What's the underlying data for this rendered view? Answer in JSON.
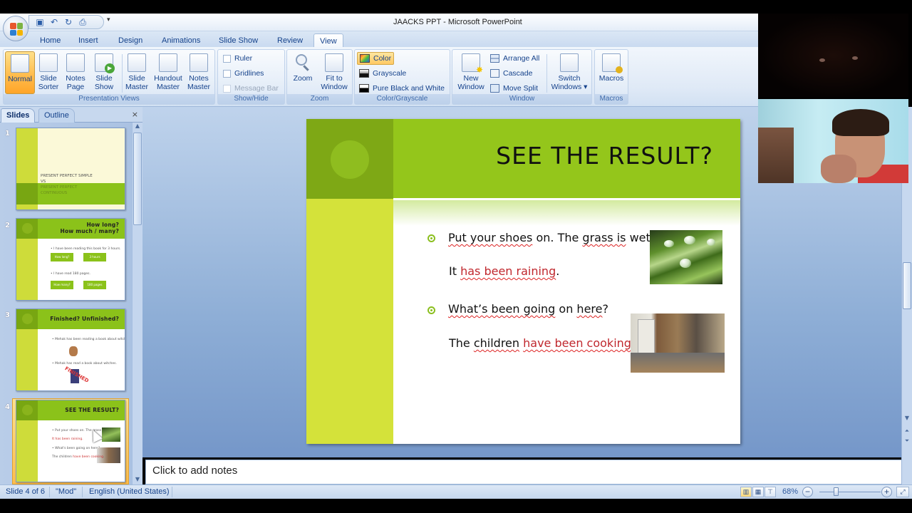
{
  "window": {
    "title": "JAACKS PPT - Microsoft PowerPoint"
  },
  "quick_access": [
    {
      "name": "save-icon",
      "glyph": "💾"
    },
    {
      "name": "undo-icon",
      "glyph": "↶"
    },
    {
      "name": "redo-icon",
      "glyph": "↻"
    },
    {
      "name": "print-icon",
      "glyph": "⎙"
    }
  ],
  "quick_access_more": "▾",
  "tabs": [
    "Home",
    "Insert",
    "Design",
    "Animations",
    "Slide Show",
    "Review",
    "View"
  ],
  "active_tab": "View",
  "ribbon": {
    "presentation_views": {
      "label": "Presentation Views",
      "buttons": [
        {
          "line1": "Normal",
          "line2": "",
          "active": true
        },
        {
          "line1": "Slide",
          "line2": "Sorter"
        },
        {
          "line1": "Notes",
          "line2": "Page"
        },
        {
          "line1": "Slide",
          "line2": "Show"
        },
        {
          "line1": "Slide",
          "line2": "Master"
        },
        {
          "line1": "Handout",
          "line2": "Master"
        },
        {
          "line1": "Notes",
          "line2": "Master"
        }
      ]
    },
    "show_hide": {
      "label": "Show/Hide",
      "items": [
        {
          "label": "Ruler",
          "checked": false,
          "enabled": true
        },
        {
          "label": "Gridlines",
          "checked": false,
          "enabled": true
        },
        {
          "label": "Message Bar",
          "checked": false,
          "enabled": false
        }
      ]
    },
    "zoom": {
      "label": "Zoom",
      "buttons": [
        {
          "line1": "Zoom",
          "line2": ""
        },
        {
          "line1": "Fit to",
          "line2": "Window"
        }
      ]
    },
    "color_grayscale": {
      "label": "Color/Grayscale",
      "items": [
        {
          "label": "Color",
          "active": true
        },
        {
          "label": "Grayscale",
          "active": false
        },
        {
          "label": "Pure Black and White",
          "active": false
        }
      ]
    },
    "window": {
      "label": "Window",
      "new_window": {
        "line1": "New",
        "line2": "Window"
      },
      "items": [
        "Arrange All",
        "Cascade",
        "Move Split"
      ],
      "switch_windows": {
        "line1": "Switch",
        "line2": "Windows ▾"
      }
    },
    "macros": {
      "label": "Macros",
      "button": "Macros"
    }
  },
  "left_panel": {
    "tabs": [
      "Slides",
      "Outline"
    ],
    "active_tab": "Slides",
    "close": "×",
    "slides": [
      {
        "number": "1",
        "title_lines": [
          "PRESENT PERFECT SIMPLE",
          "VS",
          "PRESENT PERFECT",
          "CONTINUOUS"
        ]
      },
      {
        "number": "2",
        "title_lines": [
          "How long?",
          "How much / many?"
        ],
        "boxes": [
          "How long?",
          "3 hours",
          "How many?",
          "180 pages"
        ]
      },
      {
        "number": "3",
        "title_lines": [
          "Finished?  Unfinished?"
        ],
        "stamp": "FINISHED"
      },
      {
        "number": "4",
        "title_lines": [
          "SEE THE RESULT?"
        ],
        "selected": true
      }
    ]
  },
  "slide": {
    "title": "SEE THE RESULT?",
    "bullet1": {
      "parts": [
        {
          "text": "Put your shoes",
          "style": "sq"
        },
        {
          "text": " on. The ",
          "style": ""
        },
        {
          "text": "grass is",
          "style": "sq"
        },
        {
          "text": " wet.",
          "style": ""
        }
      ]
    },
    "answer1": {
      "prefix": "It ",
      "highlight": "has been raining",
      "suffix": "."
    },
    "bullet2": {
      "parts": [
        {
          "text": "What’s been going",
          "style": "sq"
        },
        {
          "text": " on ",
          "style": ""
        },
        {
          "text": "here",
          "style": "sq"
        },
        {
          "text": "?",
          "style": ""
        }
      ]
    },
    "answer2": {
      "prefix": "The ",
      "subject": "children",
      "highlight": "have been cooking",
      "suffix": "."
    },
    "images": [
      "wet-grass-photo",
      "messy-kitchen-photo"
    ]
  },
  "notes": {
    "placeholder": "Click to add notes"
  },
  "status_bar": {
    "slide_indicator": "Slide 4 of 6",
    "theme": "\"Mod\"",
    "language": "English (United States)",
    "zoom_level": "68%",
    "zoom_percent": 68
  },
  "colors": {
    "accent_green": "#94c61b",
    "dark_green": "#7ea815",
    "lime": "#d4e23a",
    "highlight_red": "#c0272d",
    "ribbon_blue": "#15428b"
  }
}
